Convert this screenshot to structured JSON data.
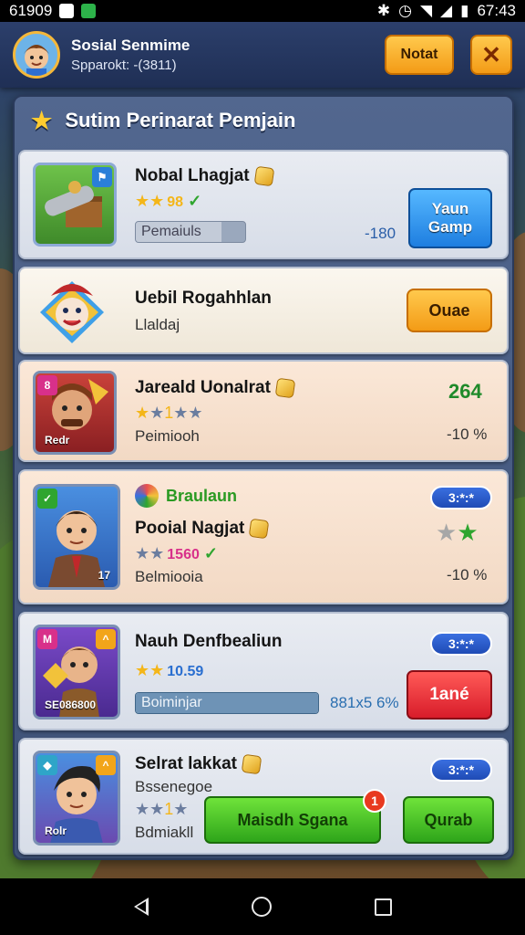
{
  "status_bar": {
    "left_text": "61909",
    "time": "67:43"
  },
  "header": {
    "user_name": "Sosial Senmime",
    "user_sub": "Spparokt: -(3811)",
    "notat_label": "Notat",
    "close_label": "✕"
  },
  "panel": {
    "title": "Sutim Perinarat Pemjain"
  },
  "rows": [
    {
      "title": "Nobal Lhagjat",
      "stars_text": "98",
      "progress_label": "Pemaiuls",
      "value": "-180",
      "button_label": "Yaun Gamp"
    },
    {
      "title": "Uebil Rogahhlan",
      "sub": "Llaldaj",
      "button_label": "Ouae"
    },
    {
      "title": "Jareald Uonalrat",
      "sub": "Peimiooh",
      "value": "264",
      "percent": "-10 %",
      "thumb_label": "Redr"
    },
    {
      "tag": "Braulaun",
      "title": "Pooial Nagjat",
      "stars_text": "1560",
      "sub": "Belmiooia",
      "pill": "3:*:*",
      "percent": "-10 %",
      "thumb_label": "17"
    },
    {
      "title": "Nauh Denfbealiun",
      "stars_text": "10.59",
      "progress_label": "Boiminjar",
      "percent": "881x5 6%",
      "pill": "3:*:*",
      "button_label": "1ané",
      "thumb_label": "SE086800"
    },
    {
      "title": "Selrat lakkat",
      "sub": "Bssenegoe",
      "sub2": "Bdmiakll",
      "pill": "3:*:*",
      "green_button": "Maisdh Sgana",
      "green_badge": "1",
      "quab_label": "Qurab",
      "thumb_label": "Rolr"
    }
  ]
}
